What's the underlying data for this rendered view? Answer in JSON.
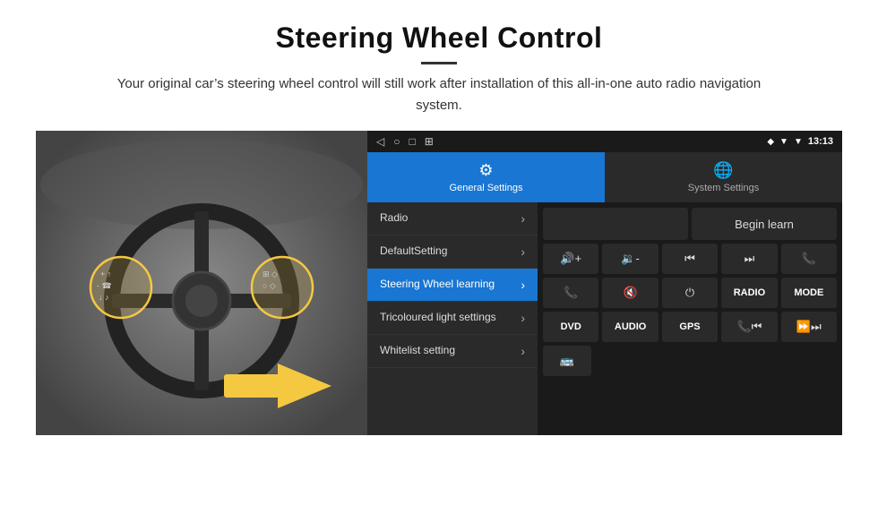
{
  "header": {
    "title": "Steering Wheel Control",
    "subtitle": "Your original car’s steering wheel control will still work after installation of this all-in-one auto radio navigation system."
  },
  "android_ui": {
    "status_bar": {
      "icons": [
        "◁",
        "○",
        "□",
        "⋮"
      ],
      "right_icons": [
        "♥",
        "▼"
      ],
      "time": "13:13",
      "location_icon": "◆"
    },
    "tabs": [
      {
        "label": "General Settings",
        "icon": "⚙",
        "active": true
      },
      {
        "label": "System Settings",
        "icon": "🌐",
        "active": false
      }
    ],
    "menu": [
      {
        "label": "Radio",
        "active": false
      },
      {
        "label": "DefaultSetting",
        "active": false
      },
      {
        "label": "Steering Wheel learning",
        "active": true
      },
      {
        "label": "Tricoloured light settings",
        "active": false
      },
      {
        "label": "Whitelist setting",
        "active": false
      }
    ],
    "begin_learn_label": "Begin learn",
    "control_buttons": {
      "row1": [
        "🔊+",
        "🔊-",
        "⏮",
        "⏭",
        "📞"
      ],
      "row2": [
        "📞",
        "🔇",
        "⏻",
        "RADIO",
        "MODE"
      ],
      "row3": [
        "DVD",
        "AUDIO",
        "GPS",
        "📞⏮",
        "⏩⏭"
      ]
    }
  }
}
